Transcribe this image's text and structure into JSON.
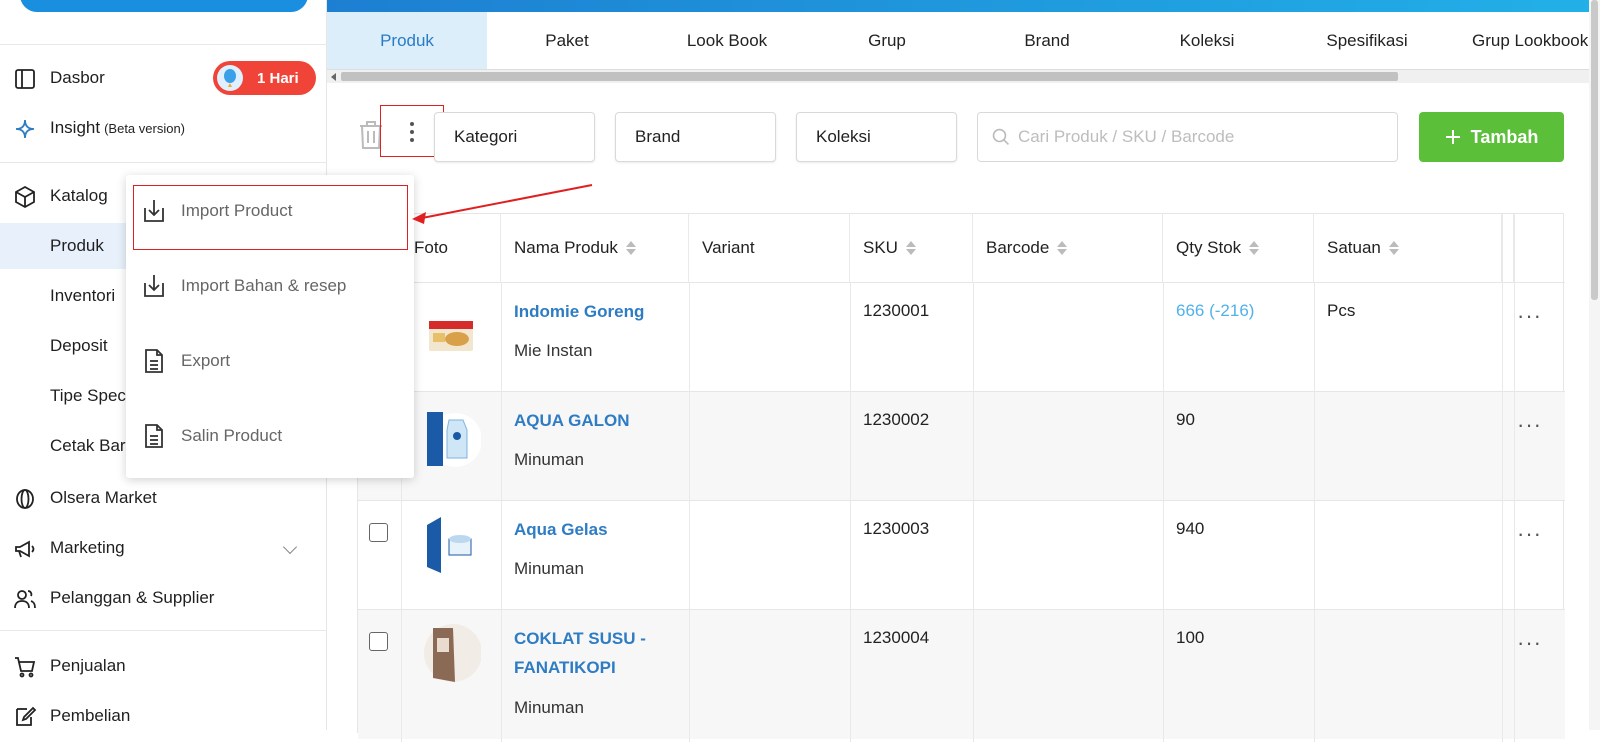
{
  "sidebar": {
    "items": [
      {
        "name": "dasbor",
        "label": "Dasbor",
        "icon": "sidebar-panel-icon"
      },
      {
        "name": "insight",
        "label": "Insight",
        "note": "(Beta version)",
        "icon": "sparkle-icon"
      },
      {
        "name": "katalog",
        "label": "Katalog",
        "icon": "box-icon"
      },
      {
        "name": "produk",
        "label": "Produk"
      },
      {
        "name": "inventori",
        "label": "Inventori"
      },
      {
        "name": "deposit",
        "label": "Deposit"
      },
      {
        "name": "tipe-spec",
        "label": "Tipe Spec"
      },
      {
        "name": "cetak-bar",
        "label": "Cetak Bar"
      },
      {
        "name": "olsera-market",
        "label": "Olsera Market",
        "icon": "globe-icon"
      },
      {
        "name": "marketing",
        "label": "Marketing",
        "icon": "megaphone-icon"
      },
      {
        "name": "pelanggan",
        "label": "Pelanggan & Supplier",
        "icon": "users-icon"
      },
      {
        "name": "penjualan",
        "label": "Penjualan",
        "icon": "cart-icon"
      },
      {
        "name": "pembelian",
        "label": "Pembelian",
        "icon": "edit-icon"
      }
    ],
    "badge": "1 Hari"
  },
  "tabs": [
    "Produk",
    "Paket",
    "Look Book",
    "Grup",
    "Brand",
    "Koleksi",
    "Spesifikasi",
    "Grup Lookbook"
  ],
  "toolbar": {
    "filters": [
      "Kategori",
      "Brand",
      "Koleksi"
    ],
    "search_placeholder": "Cari Produk / SKU / Barcode",
    "add_label": "Tambah"
  },
  "menu": {
    "items": [
      "Import Product",
      "Import Bahan & resep",
      "Export",
      "Salin Product"
    ]
  },
  "table": {
    "headers": [
      "Foto",
      "Nama Produk",
      "Variant",
      "SKU",
      "Barcode",
      "Qty Stok",
      "Satuan"
    ],
    "rows": [
      {
        "name": "Indomie Goreng",
        "category": "Mie Instan",
        "sku": "1230001",
        "qty": "666 (-216)",
        "unit": "Pcs"
      },
      {
        "name": "AQUA GALON",
        "category": "Minuman",
        "sku": "1230002",
        "qty": "90",
        "unit": ""
      },
      {
        "name": "Aqua Gelas",
        "category": "Minuman",
        "sku": "1230003",
        "qty": "940",
        "unit": ""
      },
      {
        "name": "COKLAT SUSU -",
        "name2": "FANATIKOPI",
        "category": "Minuman",
        "sku": "1230004",
        "qty": "100",
        "unit": ""
      }
    ],
    "more": "···"
  },
  "colors": {
    "accent_blue": "#2e7cc4",
    "add_green": "#5cbf3a",
    "badge_red": "#f04438",
    "highlight_red": "#e02020"
  }
}
